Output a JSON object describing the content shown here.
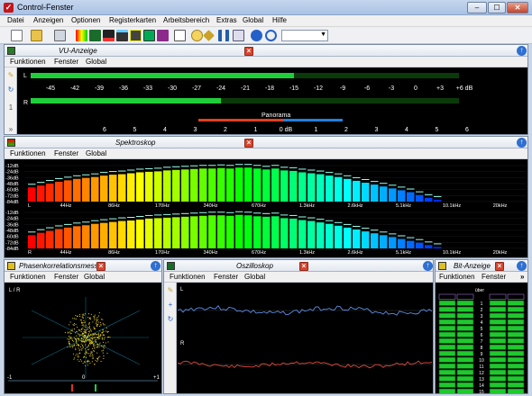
{
  "window": {
    "title": "Control-Fenster",
    "btn_min": "–",
    "btn_max": "☐",
    "btn_close": "✕"
  },
  "menu": [
    "Datei",
    "Anzeigen",
    "Optionen",
    "Registerkarten",
    "Arbeitsbereich",
    "Extras",
    "Global",
    "Hilfe"
  ],
  "toolbar_icons": [
    "new-icon",
    "open-icon",
    "copy-icon",
    "spectrum-icon",
    "vu-icon",
    "level-icon",
    "oscillo-icon",
    "phase-icon",
    "bit-icon",
    "settings-icon",
    "key-icon",
    "pause-icon",
    "link-icon",
    "help-icon",
    "refresh-icon"
  ],
  "vu": {
    "title": "VU-Anzeige",
    "menu": [
      "Funktionen",
      "Fenster",
      "Global"
    ],
    "channel_left": "L",
    "channel_right": "R",
    "scale": [
      "-45",
      "-42",
      "-39",
      "-36",
      "-33",
      "-30",
      "-27",
      "-24",
      "-21",
      "-18",
      "-15",
      "-12",
      "-9",
      "-6",
      "-3",
      "0",
      "+3",
      "+6 dB"
    ],
    "panorama_label": "Panorama",
    "pan_scale": [
      "6",
      "5",
      "4",
      "3",
      "2",
      "1",
      "0 dB",
      "1",
      "2",
      "3",
      "4",
      "5",
      "6"
    ],
    "left_level_db": -15,
    "right_level_db": -24
  },
  "spectrum": {
    "title": "Spektroskop",
    "menu": [
      "Funktionen",
      "Fenster",
      "Global"
    ],
    "db_labels": [
      "-12dB",
      "-24dB",
      "-36dB",
      "-48dB",
      "-60dB",
      "-72dB",
      "-84dB"
    ],
    "freq_labels": [
      "44Hz",
      "86Hz",
      "170Hz",
      "340Hz",
      "670Hz",
      "1.3kHz",
      "2.6kHz",
      "5.1kHz",
      "10.1kHz",
      "20kHz"
    ],
    "channel_left": "L",
    "channel_right": "R",
    "bands_left": [
      30,
      34,
      38,
      42,
      45,
      48,
      50,
      52,
      55,
      57,
      58,
      60,
      62,
      63,
      64,
      66,
      67,
      68,
      69,
      70,
      70,
      71,
      70,
      72,
      72,
      70,
      68,
      70,
      66,
      65,
      62,
      60,
      58,
      55,
      52,
      48,
      44,
      40,
      36,
      32,
      28,
      24,
      20,
      14,
      8,
      4
    ],
    "bands_right": [
      28,
      33,
      37,
      41,
      44,
      47,
      49,
      52,
      54,
      56,
      58,
      59,
      61,
      63,
      64,
      65,
      66,
      67,
      68,
      69,
      70,
      70,
      69,
      71,
      70,
      68,
      67,
      68,
      64,
      63,
      60,
      58,
      55,
      52,
      48,
      44,
      40,
      36,
      32,
      28,
      24,
      20,
      16,
      12,
      7,
      3
    ]
  },
  "phase": {
    "title": "Phasenkorrelationsmesser",
    "menu": [
      "Funktionen",
      "Fenster",
      "Global"
    ],
    "lr_label": "L / R",
    "scale_min": "-1",
    "scale_mid": "0",
    "scale_max": "+1"
  },
  "oscillo": {
    "title": "Oszilloskop",
    "menu": [
      "Funktionen",
      "Fenster",
      "Global"
    ],
    "channel_left": "L",
    "channel_right": "R"
  },
  "bits": {
    "title": "Bit-Anzeige",
    "menu": [
      "Funktionen",
      "Fenster"
    ],
    "more": "»",
    "header": "über",
    "rows": [
      "1",
      "2",
      "3",
      "4",
      "5",
      "6",
      "7",
      "8",
      "9",
      "10",
      "11",
      "12",
      "13",
      "14",
      "15"
    ]
  }
}
